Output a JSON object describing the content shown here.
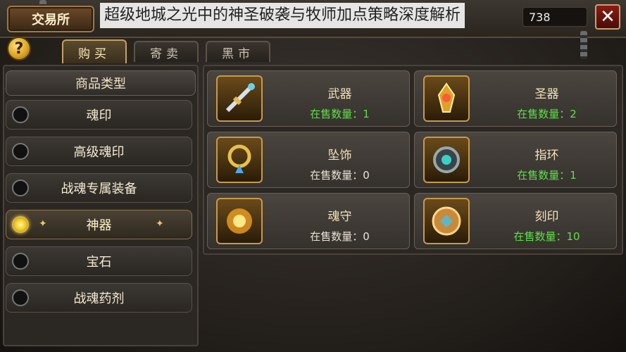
{
  "window": {
    "title": "交易所",
    "overlay_caption": "超级地城之光中的神圣破袭与牧师加点策略深度解析",
    "currency_value": "738"
  },
  "tabs": [
    {
      "label": "购买",
      "active": true
    },
    {
      "label": "寄卖",
      "active": false
    },
    {
      "label": "黑市",
      "active": false
    }
  ],
  "sidebar": {
    "header": "商品类型",
    "items": [
      {
        "label": "魂印",
        "selected": false
      },
      {
        "label": "高级魂印",
        "selected": false
      },
      {
        "label": "战魂专属装备",
        "selected": false
      },
      {
        "label": "神器",
        "selected": true
      },
      {
        "label": "宝石",
        "selected": false
      },
      {
        "label": "战魂药剂",
        "selected": false
      }
    ]
  },
  "items": [
    {
      "name": "武器",
      "count_label": "在售数量：1",
      "count": 1,
      "icon": "sword-icon"
    },
    {
      "name": "圣器",
      "count_label": "在售数量：2",
      "count": 2,
      "icon": "relic-icon"
    },
    {
      "name": "坠饰",
      "count_label": "在售数量：0",
      "count": 0,
      "icon": "pendant-icon"
    },
    {
      "name": "指环",
      "count_label": "在售数量：1",
      "count": 1,
      "icon": "ring-icon"
    },
    {
      "name": "魂守",
      "count_label": "在售数量：0",
      "count": 0,
      "icon": "soul-guard-icon"
    },
    {
      "name": "刻印",
      "count_label": "在售数量：10",
      "count": 10,
      "icon": "engraving-icon"
    }
  ],
  "colors": {
    "accent_gold": "#c8a062",
    "count_available": "#5ee04a",
    "count_empty": "#e8e2d6"
  }
}
